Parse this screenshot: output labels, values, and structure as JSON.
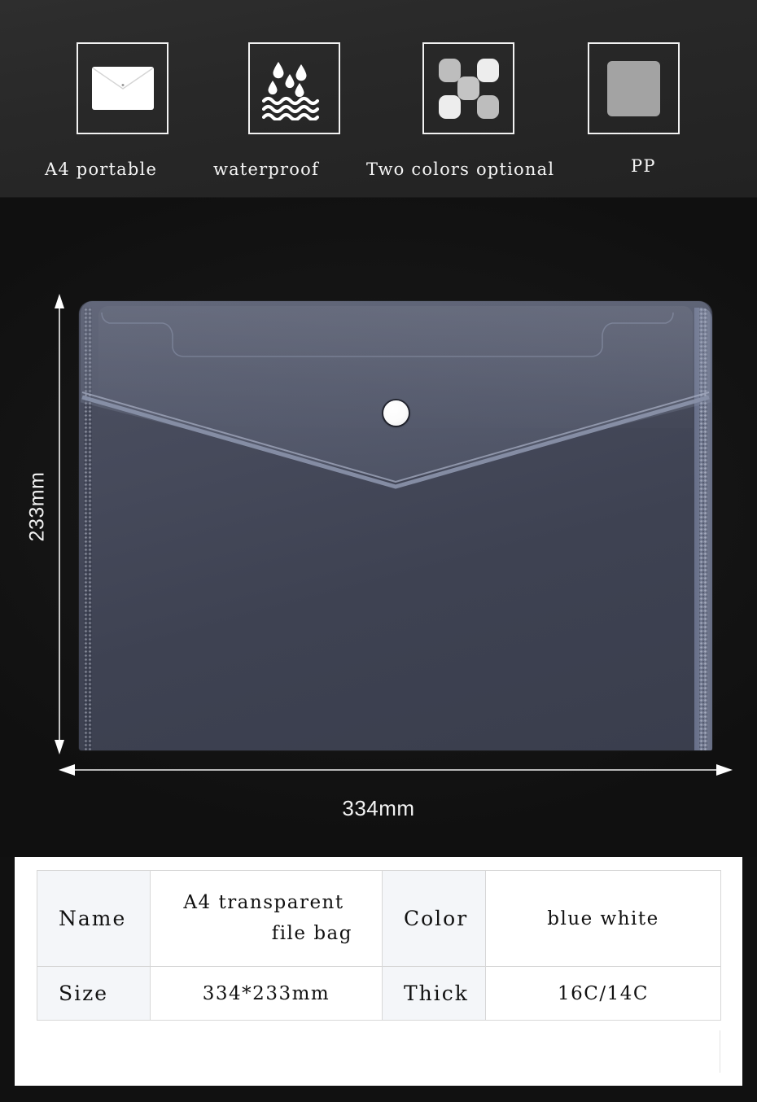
{
  "features": [
    {
      "icon": "envelope-icon",
      "label": "A4 portable"
    },
    {
      "icon": "waterdrop-waves-icon",
      "label": "waterproof"
    },
    {
      "icon": "color-swatches-icon",
      "label": "Two colors optional"
    },
    {
      "icon": "material-square-icon",
      "label": "PP"
    }
  ],
  "product": {
    "height_label": "233mm",
    "width_label": "334mm"
  },
  "spec_table": {
    "rows": [
      {
        "key1": "Name",
        "value1_line1": "A4 transparent",
        "value1_line2": "file bag",
        "key2": "Color",
        "value2": "blue white"
      },
      {
        "key1": "Size",
        "value1": "334*233mm",
        "key2": "Thick",
        "value2": "16C/14C"
      }
    ]
  },
  "colors": {
    "band_background": "#2a2a2a",
    "stage_background": "#111111",
    "bag_body": "#43475a",
    "bag_flap": "#6f7690",
    "bag_edge": "#6d748a",
    "snap_button": "#ffffff",
    "card_background": "#ffffff",
    "table_key_cell": "#f4f6f9",
    "table_border": "#d7d7d7",
    "annotation": "#f2f2f2"
  }
}
